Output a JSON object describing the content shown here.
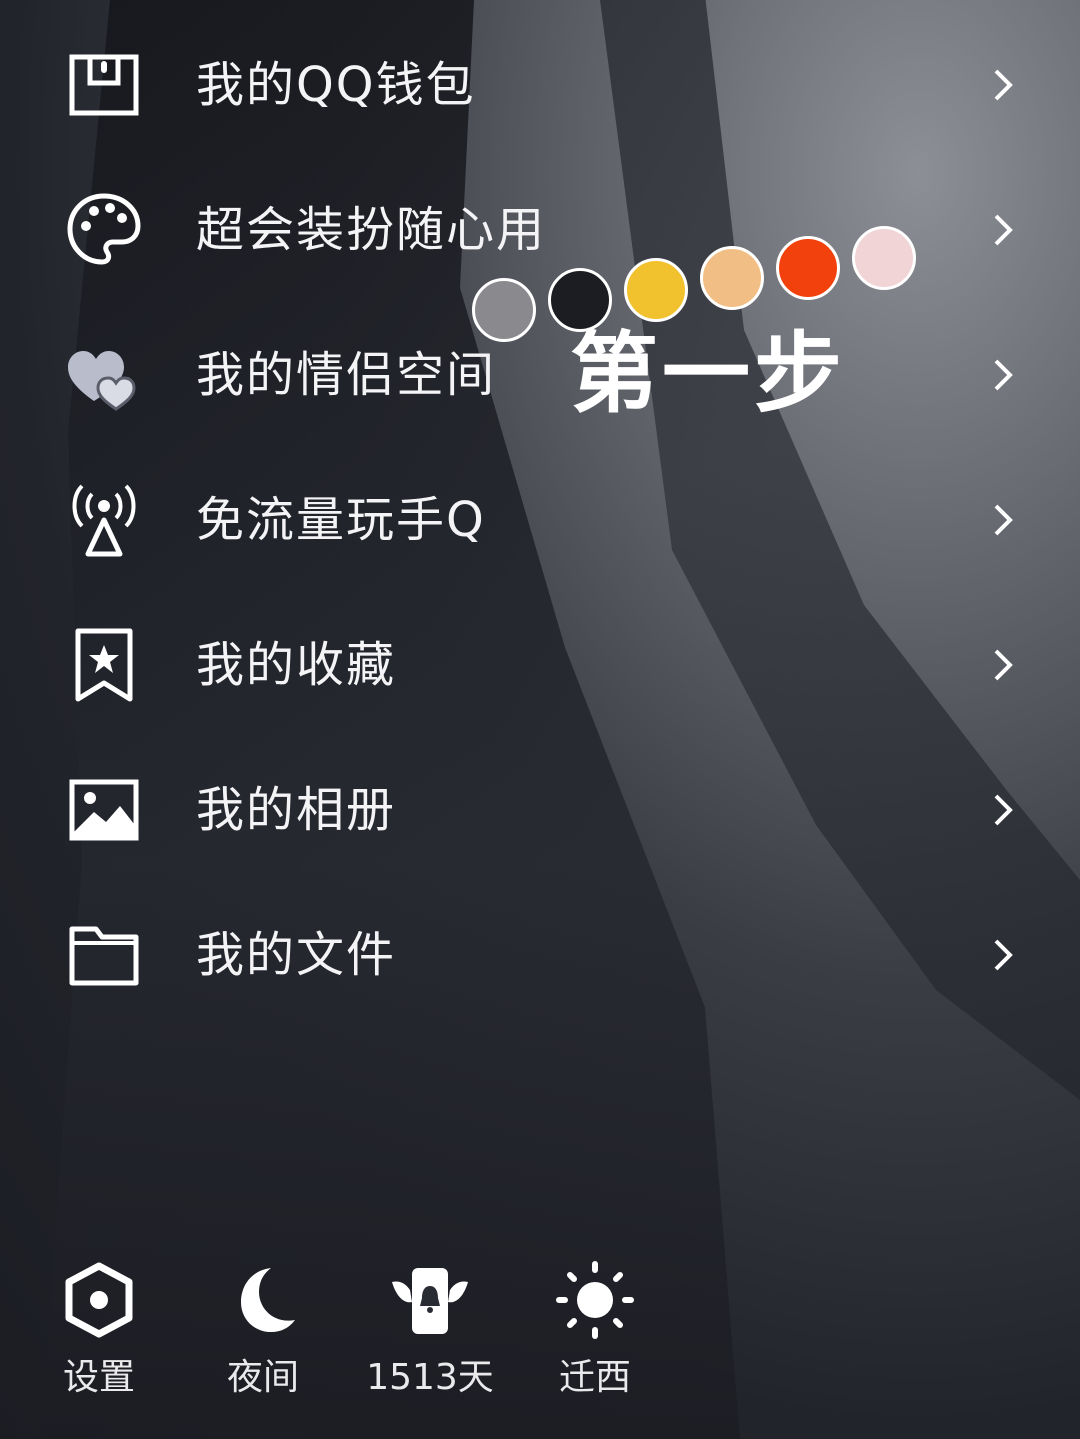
{
  "menu": {
    "items": [
      {
        "label": "我的QQ钱包",
        "icon": "wallet-icon"
      },
      {
        "label": "超会装扮随心用",
        "icon": "palette-icon"
      },
      {
        "label": "我的情侣空间",
        "icon": "hearts-icon"
      },
      {
        "label": "免流量玩手Q",
        "icon": "signal-tower-icon"
      },
      {
        "label": "我的收藏",
        "icon": "bookmark-star-icon"
      },
      {
        "label": "我的相册",
        "icon": "photo-album-icon"
      },
      {
        "label": "我的文件",
        "icon": "folder-icon"
      }
    ]
  },
  "overlay": {
    "text": "第一步"
  },
  "color_swatches": [
    "#8a8a8e",
    "#1b1d22",
    "#f2c12e",
    "#f1bf86",
    "#f2410c",
    "#f1d4d6"
  ],
  "bottom_bar": {
    "items": [
      {
        "label": "设置",
        "icon": "settings-hexagon-icon"
      },
      {
        "label": "夜间",
        "icon": "moon-icon"
      },
      {
        "label": "1513天",
        "icon": "winged-badge-icon"
      },
      {
        "label": "迁西",
        "icon": "sun-icon"
      }
    ]
  }
}
